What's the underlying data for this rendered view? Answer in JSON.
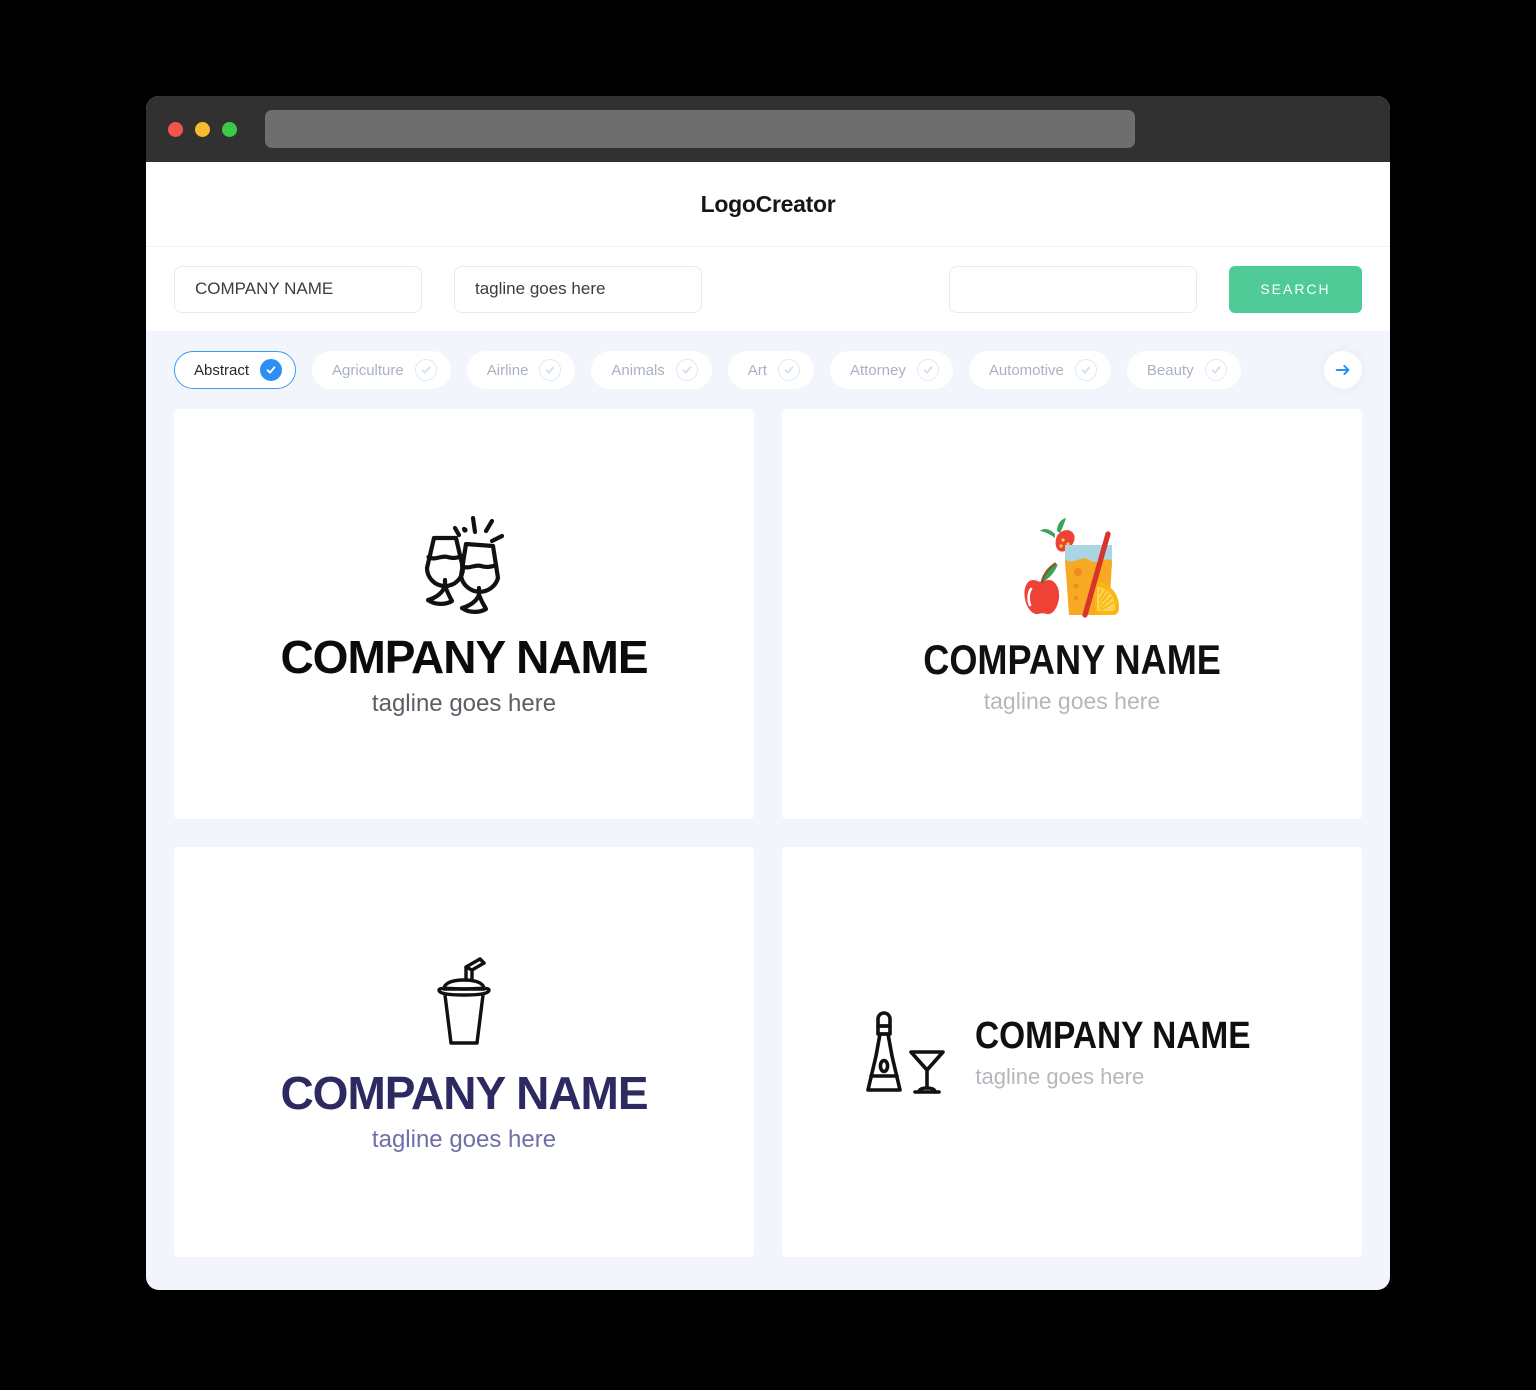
{
  "window": {
    "traffic_lights": [
      "close",
      "minimize",
      "maximize"
    ],
    "url_value": ""
  },
  "header": {
    "title": "LogoCreator"
  },
  "search": {
    "company_value": "COMPANY NAME",
    "company_placeholder": "COMPANY NAME",
    "tagline_value": "tagline goes here",
    "tagline_placeholder": "tagline goes here",
    "keyword_value": "",
    "keyword_placeholder": "",
    "search_label": "SEARCH"
  },
  "categories": {
    "items": [
      {
        "label": "Abstract",
        "selected": true
      },
      {
        "label": "Agriculture",
        "selected": false
      },
      {
        "label": "Airline",
        "selected": false
      },
      {
        "label": "Animals",
        "selected": false
      },
      {
        "label": "Art",
        "selected": false
      },
      {
        "label": "Attorney",
        "selected": false
      },
      {
        "label": "Automotive",
        "selected": false
      },
      {
        "label": "Beauty",
        "selected": false
      }
    ],
    "next_icon": "arrow-right-icon"
  },
  "logos": [
    {
      "icon": "clinking-wine-glasses-icon",
      "name": "COMPANY NAME",
      "tagline": "tagline goes here",
      "name_color": "#0b0b0b",
      "tagline_color": "#5a5f66",
      "layout": "stacked"
    },
    {
      "icon": "fruit-juice-glass-icon",
      "name": "COMPANY NAME",
      "tagline": "tagline goes here",
      "name_color": "#101010",
      "tagline_color": "#b4b7bb",
      "layout": "stacked"
    },
    {
      "icon": "takeaway-cup-with-straw-icon",
      "name": "COMPANY NAME",
      "tagline": "tagline goes here",
      "name_color": "#2d2a62",
      "tagline_color": "#6f6fa8",
      "layout": "stacked"
    },
    {
      "icon": "champagne-bottle-and-cocktail-glass-icon",
      "name": "COMPANY NAME",
      "tagline": "tagline goes here",
      "name_color": "#101010",
      "tagline_color": "#b4b7bb",
      "layout": "horizontal"
    }
  ],
  "colors": {
    "accent_green": "#4ecb97",
    "accent_blue": "#2f8ef4",
    "page_background": "#f2f5fc",
    "titlebar": "#313131"
  }
}
